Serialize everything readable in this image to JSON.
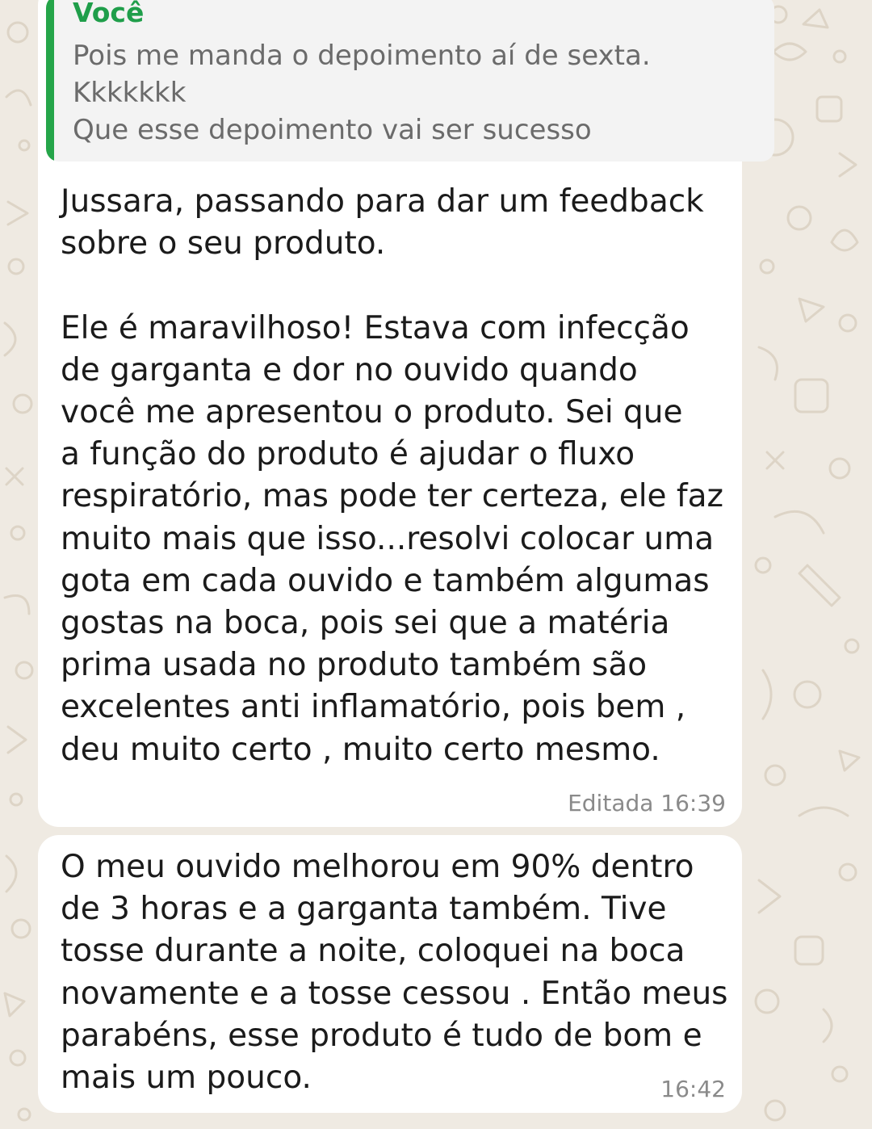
{
  "colors": {
    "wallpaper": "#efeae2",
    "bubble": "#ffffff",
    "quote_accent": "#25a549",
    "quote_author": "#1f9e4a",
    "meta_text": "#8a8a8a"
  },
  "messages": [
    {
      "quoted": {
        "author": "Você",
        "text": "Pois me manda o depoimento aí de sexta.\nKkkkkkk\nQue esse depoimento vai ser sucesso"
      },
      "text": "Jussara, passando para dar um feedback\nsobre o seu produto.\n\nEle é maravilhoso! Estava com infecção\nde garganta e dor no ouvido quando\nvocê me apresentou o produto. Sei que\na função do produto é ajudar o fluxo\nrespiratório, mas pode ter certeza, ele faz\nmuito mais que isso...resolvi colocar uma\ngota em cada ouvido e também algumas\ngostas na boca, pois sei que a matéria\nprima usada no produto também são\nexcelentes anti inflamatório, pois bem ,\ndeu muito certo , muito certo mesmo.",
      "meta": "Editada 16:39"
    },
    {
      "text": "O meu ouvido melhorou em 90% dentro\nde 3 horas e a garganta também. Tive\ntosse durante a noite, coloquei na boca\nnovamente e a tosse cessou . Então meus\nparabéns, esse produto é tudo de bom e\nmais um pouco.",
      "meta": "16:42"
    }
  ]
}
